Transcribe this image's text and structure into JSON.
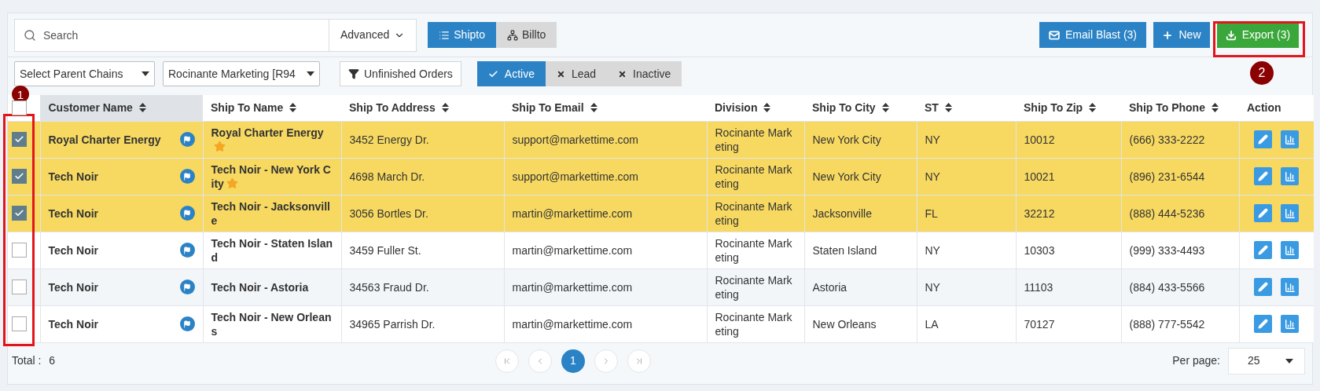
{
  "toolbar": {
    "search": {
      "placeholder": "Search"
    },
    "advanced": "Advanced",
    "views": [
      {
        "label": "Shipto",
        "kind": "list",
        "selected": true
      },
      {
        "label": "Billto",
        "kind": "tree",
        "selected": false
      }
    ],
    "actions": [
      {
        "label": "Email Blast (3)",
        "kind": "email"
      },
      {
        "label": "New",
        "kind": "new"
      },
      {
        "label": "Export (3)",
        "kind": "export"
      }
    ]
  },
  "filters": {
    "parent_chains": "Select Parent Chains",
    "division": "Rocinante Marketing [R94",
    "unfinished_orders": "Unfinished Orders",
    "statuses": [
      {
        "label": "Active",
        "selected": true
      },
      {
        "label": "Lead",
        "selected": false
      },
      {
        "label": "Inactive",
        "selected": false
      }
    ]
  },
  "table": {
    "header_checked": false,
    "columns": [
      {
        "label": "Customer Name",
        "sortable": true,
        "sorted": true
      },
      {
        "label": "Ship To Name",
        "sortable": true,
        "sorted": false
      },
      {
        "label": "Ship To Address",
        "sortable": true,
        "sorted": false
      },
      {
        "label": "Ship To Email",
        "sortable": true,
        "sorted": false
      },
      {
        "label": "Division",
        "sortable": true,
        "sorted": false
      },
      {
        "label": "Ship To City",
        "sortable": true,
        "sorted": false
      },
      {
        "label": "ST",
        "sortable": true,
        "sorted": false
      },
      {
        "label": "Ship To Zip",
        "sortable": true,
        "sorted": false
      },
      {
        "label": "Ship To Phone",
        "sortable": true,
        "sorted": false
      },
      {
        "label": "Action",
        "sortable": false,
        "sorted": false
      }
    ],
    "rows": [
      {
        "selected": true,
        "customer_name": "Royal Charter Energy",
        "ship_to_name": "Royal Charter Energy",
        "starred": true,
        "address": "3452 Energy Dr.",
        "email": "support@markettime.com",
        "division": "Rocinante Marketing",
        "city": "New York City",
        "st": "NY",
        "zip": "10012",
        "phone": "(666) 333-2222"
      },
      {
        "selected": true,
        "customer_name": "Tech Noir",
        "ship_to_name": "Tech Noir - New York City",
        "starred": true,
        "address": "4698 March Dr.",
        "email": "support@markettime.com",
        "division": "Rocinante Marketing",
        "city": "New York City",
        "st": "NY",
        "zip": "10021",
        "phone": "(896) 231-6544"
      },
      {
        "selected": true,
        "customer_name": "Tech Noir",
        "ship_to_name": "Tech Noir - Jacksonville",
        "starred": false,
        "address": "3056 Bortles Dr.",
        "email": "martin@markettime.com",
        "division": "Rocinante Marketing",
        "city": "Jacksonville",
        "st": "FL",
        "zip": "32212",
        "phone": "(888) 444-5236"
      },
      {
        "selected": false,
        "customer_name": "Tech Noir",
        "ship_to_name": "Tech Noir - Staten Island",
        "starred": false,
        "address": "3459 Fuller St.",
        "email": "martin@markettime.com",
        "division": "Rocinante Marketing",
        "city": "Staten Island",
        "st": "NY",
        "zip": "10303",
        "phone": "(999) 333-4493"
      },
      {
        "selected": false,
        "customer_name": "Tech Noir",
        "ship_to_name": "Tech Noir - Astoria",
        "starred": false,
        "address": "34563 Fraud Dr.",
        "email": "martin@markettime.com",
        "division": "Rocinante Marketing",
        "city": "Astoria",
        "st": "NY",
        "zip": "11103",
        "phone": "(884) 433-5566"
      },
      {
        "selected": false,
        "customer_name": "Tech Noir",
        "ship_to_name": "Tech Noir - New Orleans",
        "starred": false,
        "address": "34965 Parrish Dr.",
        "email": "martin@markettime.com",
        "division": "Rocinante Marketing",
        "city": "New Orleans",
        "st": "LA",
        "zip": "70127",
        "phone": "(888) 777-5542"
      }
    ]
  },
  "footer": {
    "total_label": "Total :",
    "total": "6",
    "pages": [
      {
        "label": "1",
        "selected": true
      }
    ],
    "per_page_label": "Per page:",
    "per_page": "25"
  },
  "annotations": [
    "1",
    "2"
  ]
}
